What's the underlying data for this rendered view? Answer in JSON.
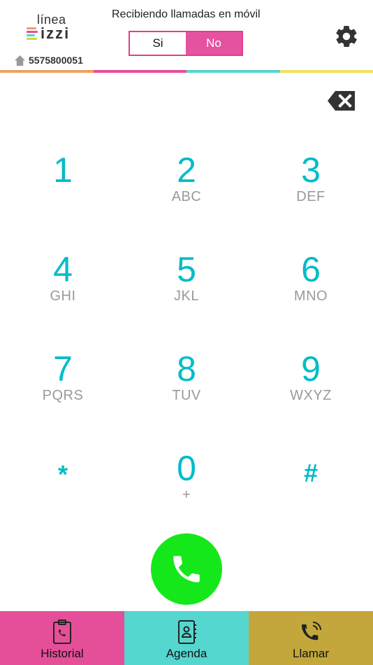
{
  "header": {
    "logo": {
      "top": "línea",
      "bottom": "izzi"
    },
    "phone_number": "5575800051",
    "receiving_label": "Recibiendo llamadas en móvil",
    "toggle": {
      "si_label": "Si",
      "no_label": "No",
      "selected": "No"
    }
  },
  "colors": {
    "accent_teal": "#00bcc9",
    "pink": "#e553a0",
    "teal": "#55d6cf",
    "gold": "#c3a73c",
    "call_green": "#15e81a",
    "strip": [
      "#f0a060",
      "#e54f99",
      "#55d6cf",
      "#f0e060"
    ]
  },
  "keypad": {
    "keys": [
      {
        "digit": "1",
        "letters": ""
      },
      {
        "digit": "2",
        "letters": "ABC"
      },
      {
        "digit": "3",
        "letters": "DEF"
      },
      {
        "digit": "4",
        "letters": "GHI"
      },
      {
        "digit": "5",
        "letters": "JKL"
      },
      {
        "digit": "6",
        "letters": "MNO"
      },
      {
        "digit": "7",
        "letters": "PQRS"
      },
      {
        "digit": "8",
        "letters": "TUV"
      },
      {
        "digit": "9",
        "letters": "WXYZ"
      },
      {
        "digit": "*",
        "letters": ""
      },
      {
        "digit": "0",
        "letters": "+"
      },
      {
        "digit": "#",
        "letters": ""
      }
    ]
  },
  "icons": {
    "settings": "gear-icon",
    "backspace": "backspace-icon",
    "call": "phone-icon",
    "home": "home-icon"
  },
  "bottom_nav": {
    "historial": "Historial",
    "agenda": "Agenda",
    "llamar": "Llamar"
  }
}
